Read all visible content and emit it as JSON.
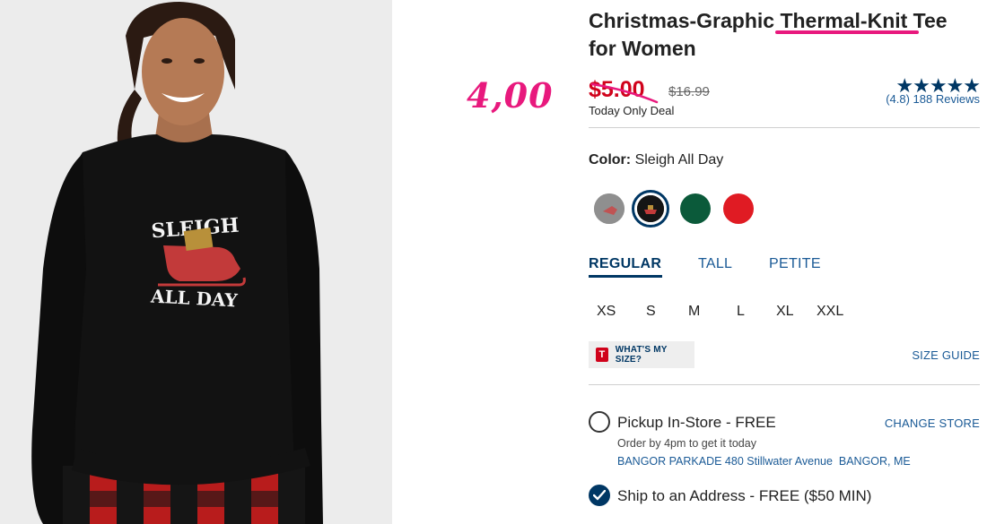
{
  "annotation": {
    "handwritten_price": "4,00",
    "accent": "#e8197d"
  },
  "product": {
    "title": "Christmas-Graphic Thermal-Knit Tee for Women",
    "shirt_graphic": {
      "line1": "SLEIGH",
      "line2": "ALL DAY"
    }
  },
  "price": {
    "sale": "$5.00",
    "original": "$16.99",
    "note": "Today Only Deal",
    "sale_color": "#d0021b"
  },
  "rating": {
    "stars": "★★★★★",
    "value": 4.8,
    "reviews_text": "(4.8) 188 Reviews"
  },
  "color": {
    "label": "Color:",
    "value": "Sleigh All Day",
    "swatches": [
      {
        "name": "heather-grey-graphic",
        "color": "#9a9a9a",
        "selected": false
      },
      {
        "name": "sleigh-all-day",
        "color": "#151515",
        "selected": true
      },
      {
        "name": "green",
        "color": "#0b5a3a",
        "selected": false
      },
      {
        "name": "red",
        "color": "#e01b23",
        "selected": false
      }
    ]
  },
  "fit": {
    "tabs": [
      "REGULAR",
      "TALL",
      "PETITE"
    ],
    "active": "REGULAR"
  },
  "sizes": [
    "XS",
    "S",
    "M",
    "L",
    "XL",
    "XXL"
  ],
  "size_help": {
    "badge": "T",
    "whats_my_size": "WHAT'S MY SIZE?",
    "size_guide": "SIZE GUIDE"
  },
  "fulfillment": {
    "pickup": {
      "label": "Pickup In-Store - FREE",
      "change_store": "CHANGE STORE",
      "order_by": "Order by 4pm to get it today",
      "store": "BANGOR PARKADE 480 Stillwater Avenue  BANGOR, ME",
      "selected": false
    },
    "ship": {
      "label": "Ship to an Address - FREE ($50 MIN)",
      "selected": true
    }
  }
}
